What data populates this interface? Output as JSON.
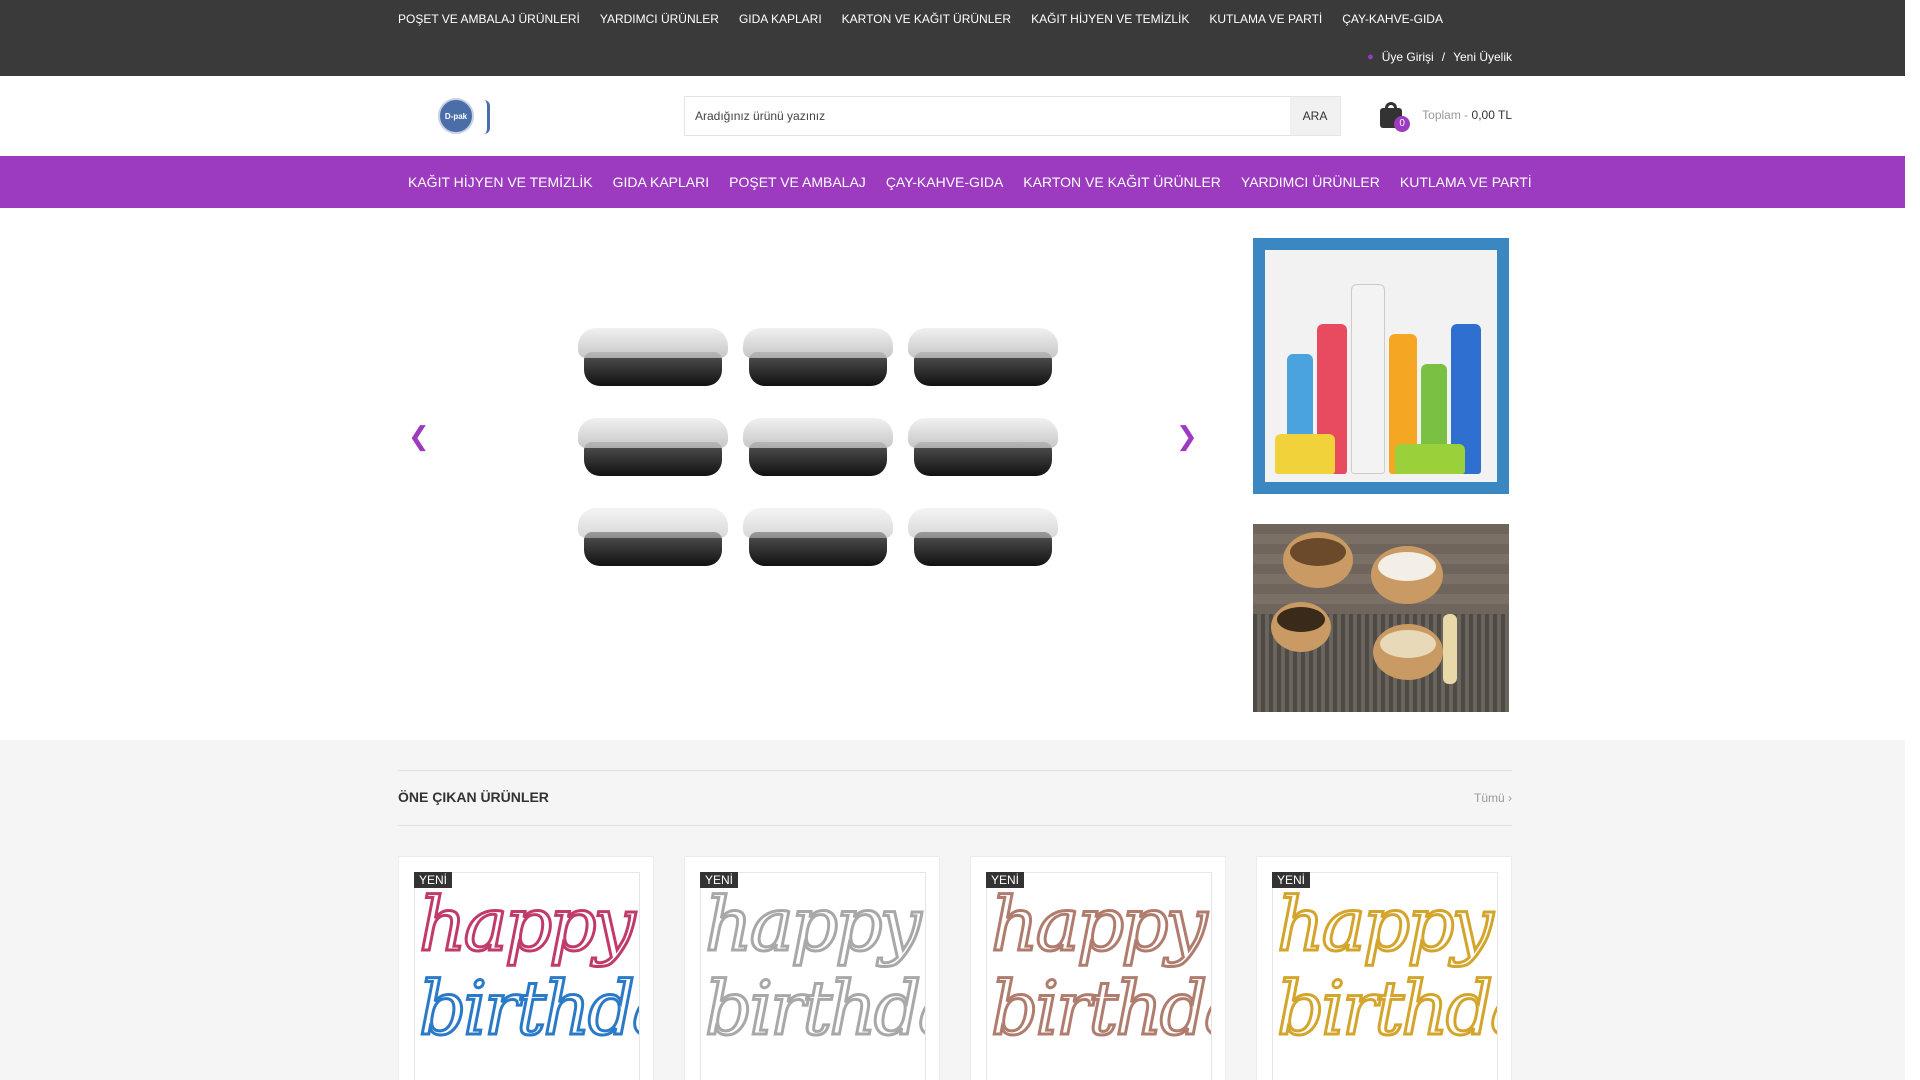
{
  "topbar": {
    "nav": [
      "POŞET VE AMBALAJ ÜRÜNLERİ",
      "YARDIMCI ÜRÜNLER",
      "GIDA KAPLARI",
      "KARTON VE KAĞIT ÜRÜNLER",
      "KAĞIT HİJYEN VE TEMİZLİK",
      "KUTLAMA VE PARTİ",
      "ÇAY-KAHVE-GIDA"
    ],
    "login": "Üye Girişi",
    "separator": "/",
    "register": "Yeni Üyelik"
  },
  "header": {
    "logo_text": "D-pak",
    "search_placeholder": "Aradığınız ürünü yazınız",
    "search_button": "ARA",
    "cart_count": "0",
    "cart_label": "Toplam -",
    "cart_total": "0,00 TL"
  },
  "mainnav": [
    "KAĞIT HİJYEN VE TEMİZLİK",
    "GIDA KAPLARI",
    "POŞET VE AMBALAJ",
    "ÇAY-KAHVE-GIDA",
    "KARTON VE KAĞIT ÜRÜNLER",
    "YARDIMCI ÜRÜNLER",
    "KUTLAMA VE PARTİ"
  ],
  "slider": {
    "prev": "❮",
    "next": "❯"
  },
  "featured": {
    "title": "ÖNE ÇIKAN ÜRÜNLER",
    "all_link": "Tümü ›",
    "products": [
      {
        "badge": "YENİ",
        "line1": "happy",
        "line2": "birthday",
        "color": "#3b6fc4"
      },
      {
        "badge": "YENİ",
        "line1": "happy",
        "line2": "birthday",
        "color": "#a8a8a8"
      },
      {
        "badge": "YENİ",
        "line1": "happy",
        "line2": "birthday",
        "color": "#b07c6e"
      },
      {
        "badge": "YENİ",
        "line1": "happy",
        "line2": "birthday",
        "color": "#d4a52c"
      }
    ]
  },
  "colors": {
    "accent": "#9c3bbf",
    "topbar": "#3a3a3a",
    "banner_frame": "#3b87c2"
  }
}
